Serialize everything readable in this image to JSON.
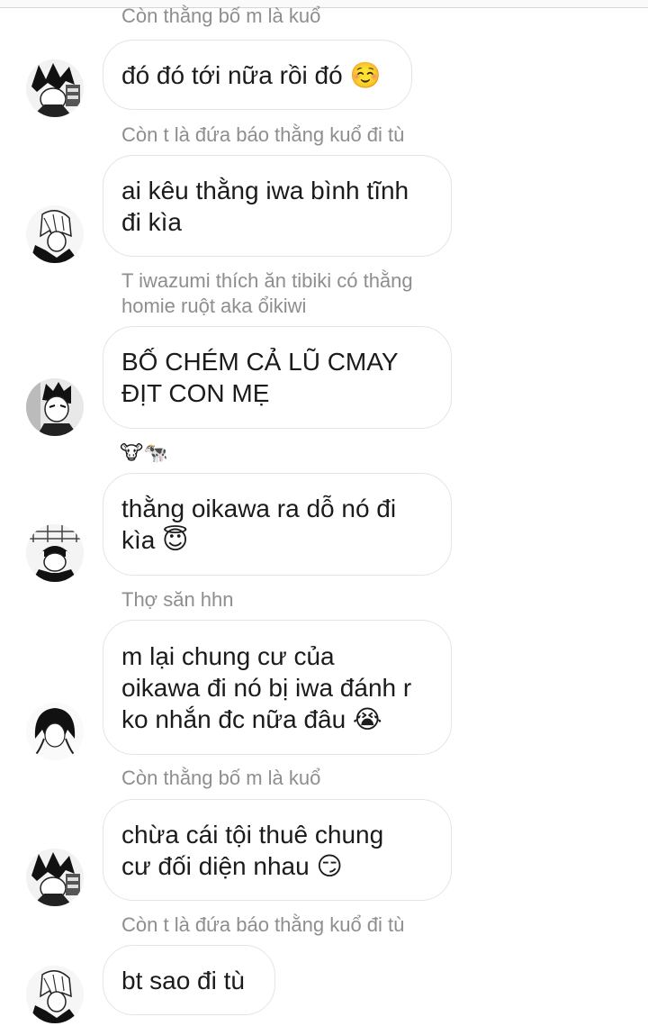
{
  "colors": {
    "background": "#ffffff",
    "sender_name": "#8e8e8e",
    "bubble_border": "#e4e4e4",
    "text": "#1b1b1b"
  },
  "messages": [
    {
      "sender": "Còn thằng bố m là kuổ",
      "text": "đó đó tới nữa rồi đó ☺️",
      "avatar_icon": "manga-avatar-1"
    },
    {
      "sender": "Còn t là đứa báo thằng kuổ đi tù",
      "text": "ai kêu thằng iwa bình tĩnh\nđi kìa",
      "avatar_icon": "manga-avatar-2"
    },
    {
      "sender": "T iwazumi thích ăn tibiki có thằng\nhomie ruột aka ổikiwi",
      "text": "BỐ CHÉM CẢ LŨ CMAY\nĐỊT CON MẸ",
      "avatar_icon": "manga-avatar-3"
    },
    {
      "sender": "🐮🐄",
      "text": "thằng oikawa ra dỗ nó đi\nkìa 😇",
      "avatar_icon": "manga-avatar-4"
    },
    {
      "sender": "Thợ săn hhn",
      "text": "m lại chung cư của\noikawa đi nó bị iwa đánh r\nko nhắn đc nữa đâu 😭",
      "avatar_icon": "manga-avatar-5"
    },
    {
      "sender": "Còn thằng bố m là kuổ",
      "text": "chừa cái tội thuê chung\ncư đối diện nhau 😏",
      "avatar_icon": "manga-avatar-1"
    },
    {
      "sender": "Còn t là đứa báo thằng kuổ đi tù",
      "text": "bt sao đi tù",
      "avatar_icon": "manga-avatar-2"
    }
  ]
}
